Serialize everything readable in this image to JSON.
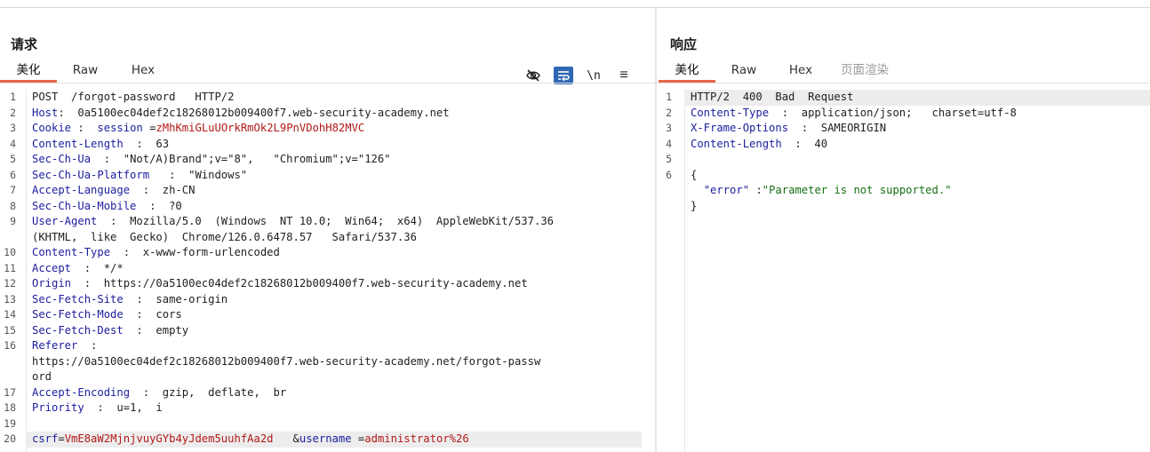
{
  "request": {
    "title": "请求",
    "tabs": [
      "美化",
      "Raw",
      "Hex"
    ],
    "lines": {
      "l1": "POST  /forgot-password   HTTP/2",
      "l2k": "Host",
      "l2v": "0a5100ec04def2c18268012b009400f7.web-security-academy.net",
      "l3k": "Cookie",
      "l3ck": "session",
      "l3cv": "zMhKmiGLuUOrkRmOk2L9PnVDohH82MVC",
      "l4k": "Content-Length",
      "l4v": "63",
      "l5k": "Sec-Ch-Ua",
      "l5v": "\"Not/A)Brand\";v=\"8\",   \"Chromium\";v=\"126\"",
      "l6k": "Sec-Ch-Ua-Platform",
      "l6v": "\"Windows\"",
      "l7k": "Accept-Language",
      "l7v": "zh-CN",
      "l8k": "Sec-Ch-Ua-Mobile",
      "l8v": "?0",
      "l9k": "User-Agent",
      "l9v": "Mozilla/5.0  (Windows  NT 10.0;  Win64;  x64)  AppleWebKit/537.36",
      "l9w": "(KHTML,  like  Gecko)  Chrome/126.0.6478.57   Safari/537.36",
      "l10k": "Content-Type",
      "l10v": "x-www-form-urlencoded",
      "l11k": "Accept",
      "l11v": "*/*",
      "l12k": "Origin",
      "l12v": "https://0a5100ec04def2c18268012b009400f7.web-security-academy.net",
      "l13k": "Sec-Fetch-Site",
      "l13v": "same-origin",
      "l14k": "Sec-Fetch-Mode",
      "l14v": "cors",
      "l15k": "Sec-Fetch-Dest",
      "l15v": "empty",
      "l16k": "Referer",
      "l16w1": "https://0a5100ec04def2c18268012b009400f7.web-security-academy.net/forgot-passw",
      "l16w2": "ord",
      "l17k": "Accept-Encoding",
      "l17v": "gzip,  deflate,  br",
      "l18k": "Priority",
      "l18v": "u=1,  i",
      "l20k1": "csrf",
      "l20v1": "VmE8aW2MjnjvuyGYb4yJdem5uuhfAa2d",
      "l20k2": "username",
      "l20v2": "administrator%26"
    }
  },
  "response": {
    "title": "响应",
    "tabs": [
      "美化",
      "Raw",
      "Hex",
      "页面渲染"
    ],
    "lines": {
      "l1": "HTTP/2  400  Bad  Request",
      "l2k": "Content-Type",
      "l2v": "application/json;   charset=utf-8",
      "l3k": "X-Frame-Options",
      "l3v": "SAMEORIGIN",
      "l4k": "Content-Length",
      "l4v": "40",
      "l6a": "{",
      "l6bk": "\"error\"",
      "l6bv": "\"Parameter is not supported.\"",
      "l6c": "}"
    }
  },
  "toolbar": {
    "icons": [
      "hide-icon",
      "wrap-icon",
      "newline-icon",
      "menu-icon"
    ],
    "newline_label": "\\n",
    "menu_label": "≡",
    "active_color": "#2f67b2"
  },
  "colors": {
    "accent": "#e8684a",
    "header_key": "#1c1c9f",
    "param_value": "#b41818",
    "json_string": "#177017"
  }
}
